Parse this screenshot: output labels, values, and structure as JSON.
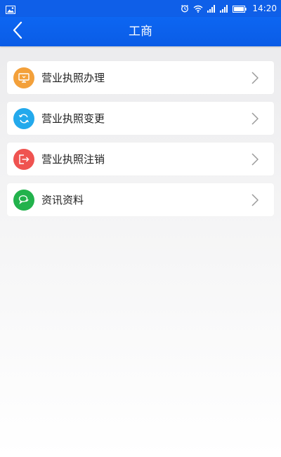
{
  "status_bar": {
    "time": "14:20",
    "icons": [
      "image-icon",
      "alarm-icon",
      "wifi-icon",
      "signal-icon",
      "signal-icon",
      "battery-icon"
    ],
    "background": "#0f5fe8"
  },
  "nav": {
    "title": "工商",
    "back_icon": "chevron-left-icon",
    "background": "#0d66f2"
  },
  "menu": {
    "items": [
      {
        "label": "营业执照办理",
        "icon": "monitor-icon",
        "icon_color": "#f3a03a"
      },
      {
        "label": "营业执照变更",
        "icon": "refresh-icon",
        "icon_color": "#23a9ec"
      },
      {
        "label": "营业执照注销",
        "icon": "exit-icon",
        "icon_color": "#ef5350"
      },
      {
        "label": "资讯资料",
        "icon": "chat-icon",
        "icon_color": "#22b24c"
      }
    ],
    "chevron_icon": "chevron-right-icon"
  }
}
